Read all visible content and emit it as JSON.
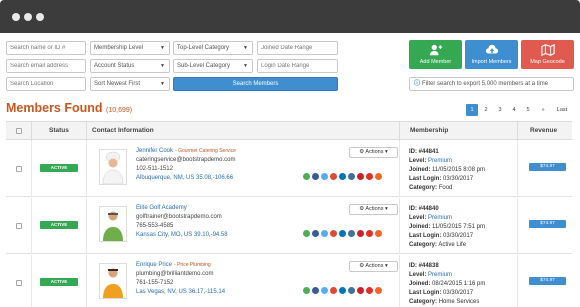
{
  "filters": {
    "search_name_ph": "Search name or ID #",
    "search_email_ph": "Search email address",
    "search_location_ph": "Search Location",
    "membership_level": "Membership Level",
    "account_status": "Account Status",
    "sort": "Sort Newest First",
    "top_category": "Top-Level Category",
    "sub_category": "Sub-Level Category",
    "joined_range_ph": "Joined Date Range",
    "login_range_ph": "Login Date Range",
    "search_button": "Search Members"
  },
  "actions": {
    "add_member": "Add Member",
    "import_members": "Import Members",
    "map_geocode": "Map Geocode",
    "export_note": "Filter search to export 5,000 members at a time"
  },
  "header": {
    "title": "Members Found",
    "count": "(10,699)"
  },
  "pagination": [
    "1",
    "2",
    "3",
    "4",
    "5",
    "»",
    "Last"
  ],
  "table": {
    "columns": {
      "status": "Status",
      "contact": "Contact Information",
      "membership": "Membership",
      "revenue": "Revenue"
    },
    "rows": [
      {
        "status": "ACTIVE",
        "name": "Jennifer Cook",
        "company": "- Gourmet Catering Service",
        "email": "cateringservice@bootstrapdemo.com",
        "phone": "102-511-1512",
        "location": "Albuquerque, NM, US   35.08,-106.66",
        "actions": "Actions",
        "id_label": "ID:",
        "id": "#44841",
        "level_label": "Level:",
        "level": "Premium",
        "joined_label": "Joined:",
        "joined": "11/05/2015 8:08 pm",
        "login_label": "Last Login:",
        "login": "03/30/2017",
        "category_label": "Category:",
        "category": "Food",
        "revenue": "$74.97"
      },
      {
        "status": "ACTIVE",
        "name": "Elite Golf Academy",
        "company": "",
        "email": "golftrainer@bootstrapdemo.com",
        "phone": "765-553-4585",
        "location": "Kansas City, MO, US   39.10,-94.58",
        "actions": "Actions",
        "id_label": "ID:",
        "id": "#44840",
        "level_label": "Level:",
        "level": "Premium",
        "joined_label": "Joined:",
        "joined": "11/05/2015 7:51 pm",
        "login_label": "Last Login:",
        "login": "03/30/2017",
        "category_label": "Category:",
        "category": "Active Life",
        "revenue": "$74.97"
      },
      {
        "status": "ACTIVE",
        "name": "Enrique Price",
        "company": "- Price Plumbing",
        "email": "plumbing@brilliantdemo.com",
        "phone": "761-155-7152",
        "location": "Las Vegas, NV, US   36.17,-115.14",
        "actions": "Actions",
        "id_label": "ID:",
        "id": "#44838",
        "level_label": "Level:",
        "level": "Premium",
        "joined_label": "Joined:",
        "joined": "08/24/2015 1:16 pm",
        "login_label": "Last Login:",
        "login": "03/30/2017",
        "category_label": "Category:",
        "category": "Home Services",
        "revenue": "$74.97"
      }
    ]
  },
  "colors": {
    "accent": "#3e8ed0",
    "add": "#34a853",
    "import": "#3e8ed0",
    "map": "#e05a4f",
    "title": "#c8581f"
  }
}
